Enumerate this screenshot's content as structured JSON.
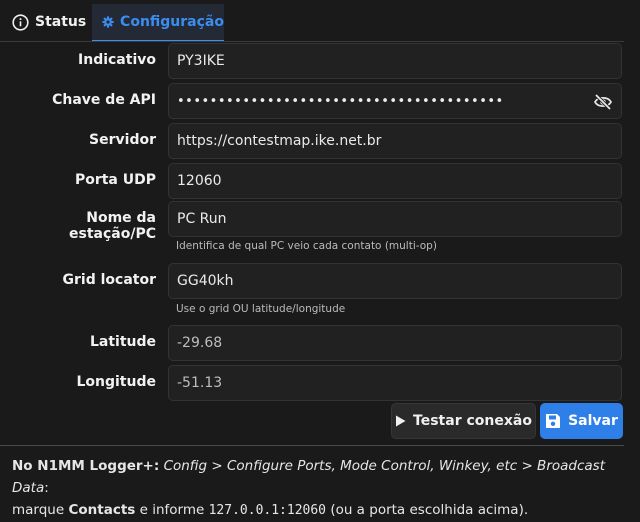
{
  "tabs": [
    {
      "label": "Status",
      "icon": "info-icon"
    },
    {
      "label": "Configuração",
      "icon": "gear-icon",
      "active": true
    }
  ],
  "form": {
    "callsign": {
      "label": "Indicativo",
      "value": "PY3IKE"
    },
    "api_key": {
      "label": "Chave de API",
      "value": "••••••••••••••••••••••••••••••••••••••••",
      "icon": "eye-off-icon"
    },
    "server": {
      "label": "Servidor",
      "value": "https://contestmap.ike.net.br"
    },
    "udp_port": {
      "label": "Porta UDP",
      "value": "12060"
    },
    "station": {
      "label": "Nome da estação/PC",
      "value": "PC Run",
      "hint": "Identifica de qual PC veio cada contato (multi-op)"
    },
    "grid": {
      "label": "Grid locator",
      "value": "GG40kh",
      "hint": "Use o grid OU latitude/longitude"
    },
    "latitude": {
      "label": "Latitude",
      "value": "-29.68"
    },
    "longitude": {
      "label": "Longitude",
      "value": "-51.13"
    }
  },
  "actions": {
    "test_label": "Testar conexão",
    "save_label": "Salvar"
  },
  "footer": {
    "app": "No N1MM Logger+:",
    "path": "Config > Configure Ports, Mode Control, Winkey, etc > Broadcast Data",
    "colon": ":",
    "line2_a": "marque",
    "contacts": "Contacts",
    "line2_b": "e informe",
    "address": "127.0.0.1:12060",
    "line2_c": "(ou a porta escolhida acima)."
  },
  "colors": {
    "accent": "#3b8df0",
    "save_button": "#2f7fe9",
    "background": "#1a1a1a"
  }
}
